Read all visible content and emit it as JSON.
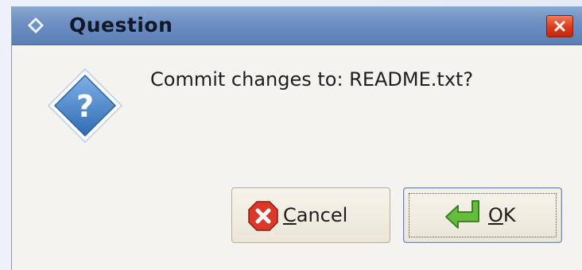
{
  "dialog": {
    "title": "Question",
    "message": "Commit changes to: README.txt?",
    "buttons": {
      "cancel": {
        "mnemonic": "C",
        "rest": "ancel"
      },
      "ok": {
        "mnemonic": "O",
        "rest": "K"
      }
    }
  },
  "icons": {
    "title": "question-diamond-icon",
    "close": "close-icon",
    "main": "question-diamond-icon",
    "cancel": "cancel-x-icon",
    "ok": "green-enter-arrow-icon"
  },
  "colors": {
    "titlebar": "#6b8fc2",
    "close": "#dc3a1a",
    "dialog_bg": "#f5f3ef",
    "icon_blue": "#4f86c6",
    "cancel_red": "#d9382a",
    "ok_green": "#5fb63a"
  }
}
